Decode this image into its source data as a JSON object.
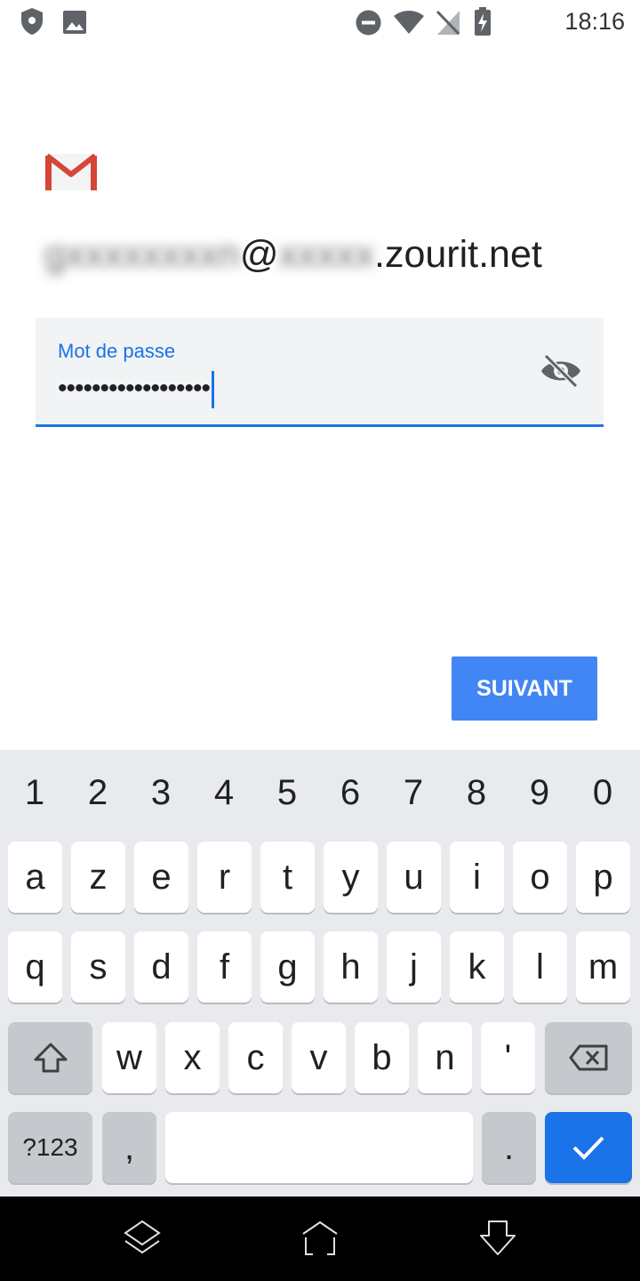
{
  "status_bar": {
    "time": "18:16"
  },
  "account": {
    "email_hidden_user": "gxxxxxxxxn",
    "at": "@",
    "email_hidden_domain": "xxxxx",
    "email_visible": ".zourit.net"
  },
  "password": {
    "label": "Mot de passe",
    "masked_value": "••••••••••••••••••"
  },
  "next_button": {
    "label": "SUIVANT"
  },
  "keyboard": {
    "number_row": [
      "1",
      "2",
      "3",
      "4",
      "5",
      "6",
      "7",
      "8",
      "9",
      "0"
    ],
    "row1": [
      "a",
      "z",
      "e",
      "r",
      "t",
      "y",
      "u",
      "i",
      "o",
      "p"
    ],
    "row2": [
      "q",
      "s",
      "d",
      "f",
      "g",
      "h",
      "j",
      "k",
      "l",
      "m"
    ],
    "row3": [
      "w",
      "x",
      "c",
      "v",
      "b",
      "n",
      "'"
    ],
    "symbols_label": "?123",
    "comma": ",",
    "period": "."
  },
  "colors": {
    "accent": "#1a73e8",
    "button": "#4285f4",
    "field_bg": "#f1f3f4",
    "keyboard_bg": "#e8eaed"
  }
}
